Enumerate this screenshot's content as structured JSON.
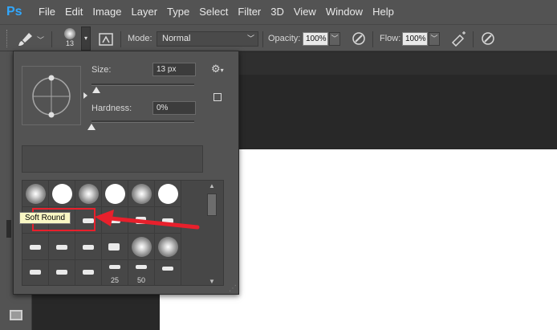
{
  "app": {
    "logo": "Ps"
  },
  "menu": [
    "File",
    "Edit",
    "Image",
    "Layer",
    "Type",
    "Select",
    "Filter",
    "3D",
    "View",
    "Window",
    "Help"
  ],
  "options_bar": {
    "brush_size_value": "13",
    "mode_label": "Mode:",
    "mode_value": "Normal",
    "opacity_label": "Opacity:",
    "opacity_value": "100%",
    "flow_label": "Flow:",
    "flow_value": "100%"
  },
  "picker": {
    "size_label": "Size:",
    "size_value": "13 px",
    "hardness_label": "Hardness:",
    "hardness_value": "0%",
    "size_slider_fraction": 0.05,
    "hardness_slider_fraction": 0.0,
    "tooltip": "Soft Round",
    "grid_numbers": [
      "25",
      "50"
    ]
  },
  "colors": {
    "annotation_red": "#e8202c",
    "tooltip_bg": "#f9f7c4",
    "ps_blue": "#31a8ff"
  },
  "icons": [
    "brush-icon",
    "chevron-down-icon",
    "brush-panel-icon",
    "airbrush-icon",
    "pressure-opacity-icon",
    "pressure-size-icon",
    "gear-icon",
    "new-preset-icon",
    "resize-grip-icon"
  ]
}
